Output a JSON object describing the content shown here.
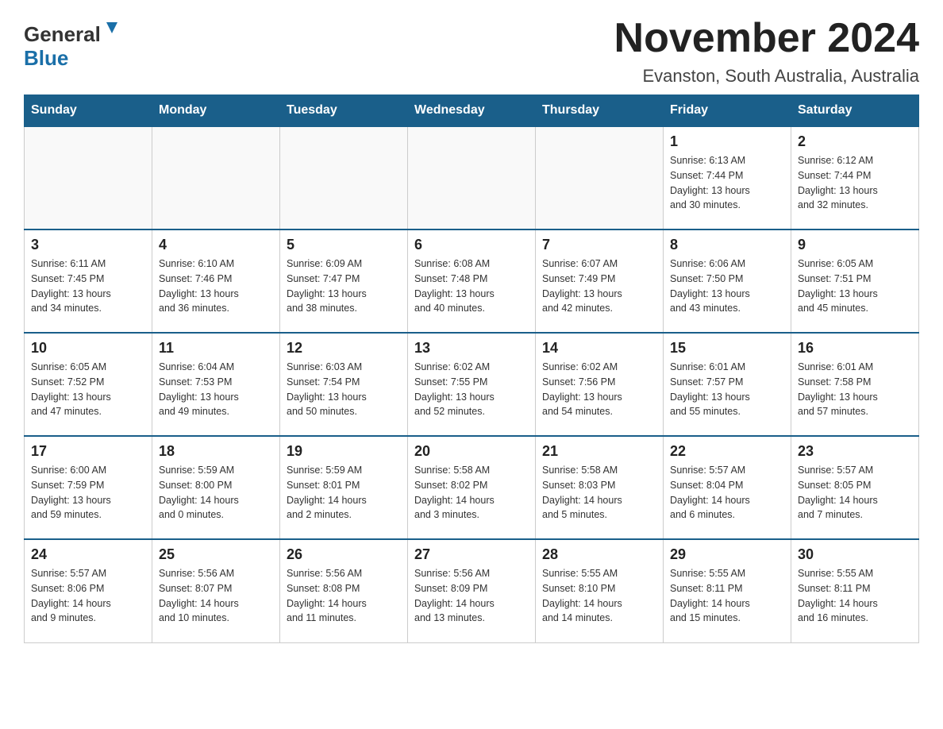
{
  "logo": {
    "general": "General",
    "blue": "Blue"
  },
  "title": "November 2024",
  "subtitle": "Evanston, South Australia, Australia",
  "days_of_week": [
    "Sunday",
    "Monday",
    "Tuesday",
    "Wednesday",
    "Thursday",
    "Friday",
    "Saturday"
  ],
  "weeks": [
    {
      "days": [
        {
          "number": "",
          "info": "",
          "empty": true
        },
        {
          "number": "",
          "info": "",
          "empty": true
        },
        {
          "number": "",
          "info": "",
          "empty": true
        },
        {
          "number": "",
          "info": "",
          "empty": true
        },
        {
          "number": "",
          "info": "",
          "empty": true
        },
        {
          "number": "1",
          "info": "Sunrise: 6:13 AM\nSunset: 7:44 PM\nDaylight: 13 hours\nand 30 minutes."
        },
        {
          "number": "2",
          "info": "Sunrise: 6:12 AM\nSunset: 7:44 PM\nDaylight: 13 hours\nand 32 minutes."
        }
      ]
    },
    {
      "days": [
        {
          "number": "3",
          "info": "Sunrise: 6:11 AM\nSunset: 7:45 PM\nDaylight: 13 hours\nand 34 minutes."
        },
        {
          "number": "4",
          "info": "Sunrise: 6:10 AM\nSunset: 7:46 PM\nDaylight: 13 hours\nand 36 minutes."
        },
        {
          "number": "5",
          "info": "Sunrise: 6:09 AM\nSunset: 7:47 PM\nDaylight: 13 hours\nand 38 minutes."
        },
        {
          "number": "6",
          "info": "Sunrise: 6:08 AM\nSunset: 7:48 PM\nDaylight: 13 hours\nand 40 minutes."
        },
        {
          "number": "7",
          "info": "Sunrise: 6:07 AM\nSunset: 7:49 PM\nDaylight: 13 hours\nand 42 minutes."
        },
        {
          "number": "8",
          "info": "Sunrise: 6:06 AM\nSunset: 7:50 PM\nDaylight: 13 hours\nand 43 minutes."
        },
        {
          "number": "9",
          "info": "Sunrise: 6:05 AM\nSunset: 7:51 PM\nDaylight: 13 hours\nand 45 minutes."
        }
      ]
    },
    {
      "days": [
        {
          "number": "10",
          "info": "Sunrise: 6:05 AM\nSunset: 7:52 PM\nDaylight: 13 hours\nand 47 minutes."
        },
        {
          "number": "11",
          "info": "Sunrise: 6:04 AM\nSunset: 7:53 PM\nDaylight: 13 hours\nand 49 minutes."
        },
        {
          "number": "12",
          "info": "Sunrise: 6:03 AM\nSunset: 7:54 PM\nDaylight: 13 hours\nand 50 minutes."
        },
        {
          "number": "13",
          "info": "Sunrise: 6:02 AM\nSunset: 7:55 PM\nDaylight: 13 hours\nand 52 minutes."
        },
        {
          "number": "14",
          "info": "Sunrise: 6:02 AM\nSunset: 7:56 PM\nDaylight: 13 hours\nand 54 minutes."
        },
        {
          "number": "15",
          "info": "Sunrise: 6:01 AM\nSunset: 7:57 PM\nDaylight: 13 hours\nand 55 minutes."
        },
        {
          "number": "16",
          "info": "Sunrise: 6:01 AM\nSunset: 7:58 PM\nDaylight: 13 hours\nand 57 minutes."
        }
      ]
    },
    {
      "days": [
        {
          "number": "17",
          "info": "Sunrise: 6:00 AM\nSunset: 7:59 PM\nDaylight: 13 hours\nand 59 minutes."
        },
        {
          "number": "18",
          "info": "Sunrise: 5:59 AM\nSunset: 8:00 PM\nDaylight: 14 hours\nand 0 minutes."
        },
        {
          "number": "19",
          "info": "Sunrise: 5:59 AM\nSunset: 8:01 PM\nDaylight: 14 hours\nand 2 minutes."
        },
        {
          "number": "20",
          "info": "Sunrise: 5:58 AM\nSunset: 8:02 PM\nDaylight: 14 hours\nand 3 minutes."
        },
        {
          "number": "21",
          "info": "Sunrise: 5:58 AM\nSunset: 8:03 PM\nDaylight: 14 hours\nand 5 minutes."
        },
        {
          "number": "22",
          "info": "Sunrise: 5:57 AM\nSunset: 8:04 PM\nDaylight: 14 hours\nand 6 minutes."
        },
        {
          "number": "23",
          "info": "Sunrise: 5:57 AM\nSunset: 8:05 PM\nDaylight: 14 hours\nand 7 minutes."
        }
      ]
    },
    {
      "days": [
        {
          "number": "24",
          "info": "Sunrise: 5:57 AM\nSunset: 8:06 PM\nDaylight: 14 hours\nand 9 minutes."
        },
        {
          "number": "25",
          "info": "Sunrise: 5:56 AM\nSunset: 8:07 PM\nDaylight: 14 hours\nand 10 minutes."
        },
        {
          "number": "26",
          "info": "Sunrise: 5:56 AM\nSunset: 8:08 PM\nDaylight: 14 hours\nand 11 minutes."
        },
        {
          "number": "27",
          "info": "Sunrise: 5:56 AM\nSunset: 8:09 PM\nDaylight: 14 hours\nand 13 minutes."
        },
        {
          "number": "28",
          "info": "Sunrise: 5:55 AM\nSunset: 8:10 PM\nDaylight: 14 hours\nand 14 minutes."
        },
        {
          "number": "29",
          "info": "Sunrise: 5:55 AM\nSunset: 8:11 PM\nDaylight: 14 hours\nand 15 minutes."
        },
        {
          "number": "30",
          "info": "Sunrise: 5:55 AM\nSunset: 8:11 PM\nDaylight: 14 hours\nand 16 minutes."
        }
      ]
    }
  ],
  "colors": {
    "header_bg": "#1a5f8a",
    "header_text": "#ffffff",
    "border": "#1a5f8a",
    "day_number": "#222222",
    "day_info": "#333333"
  }
}
